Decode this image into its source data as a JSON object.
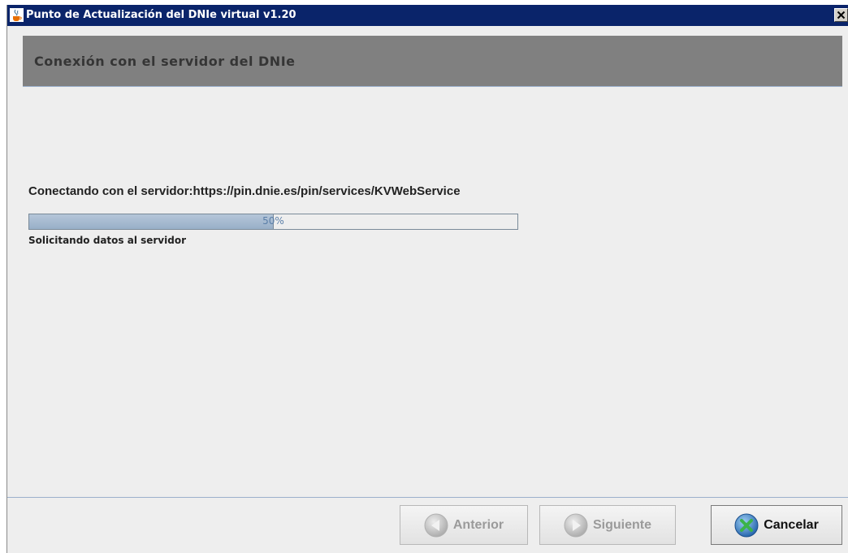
{
  "window": {
    "title": "Punto de Actualización del DNIe virtual v1.20",
    "icon": "java-cup-icon"
  },
  "header": {
    "title": "Conexión con el servidor del DNIe"
  },
  "main": {
    "connecting_label": "Conectando con el servidor:https://pin.dnie.es/pin/services/KVWebService",
    "progress": {
      "value": 0.5,
      "label": "50%"
    },
    "status": "Solicitando datos al servidor"
  },
  "footer": {
    "prev_label": "Anterior",
    "next_label": "Siguiente",
    "cancel_label": "Cancelar",
    "prev_icon": "arrow-left-icon",
    "next_icon": "arrow-right-icon",
    "cancel_icon": "cancel-x-icon"
  },
  "colors": {
    "titlebar": "#0a246a",
    "header_banner": "#808080",
    "progress_fill": "#98afc8"
  }
}
